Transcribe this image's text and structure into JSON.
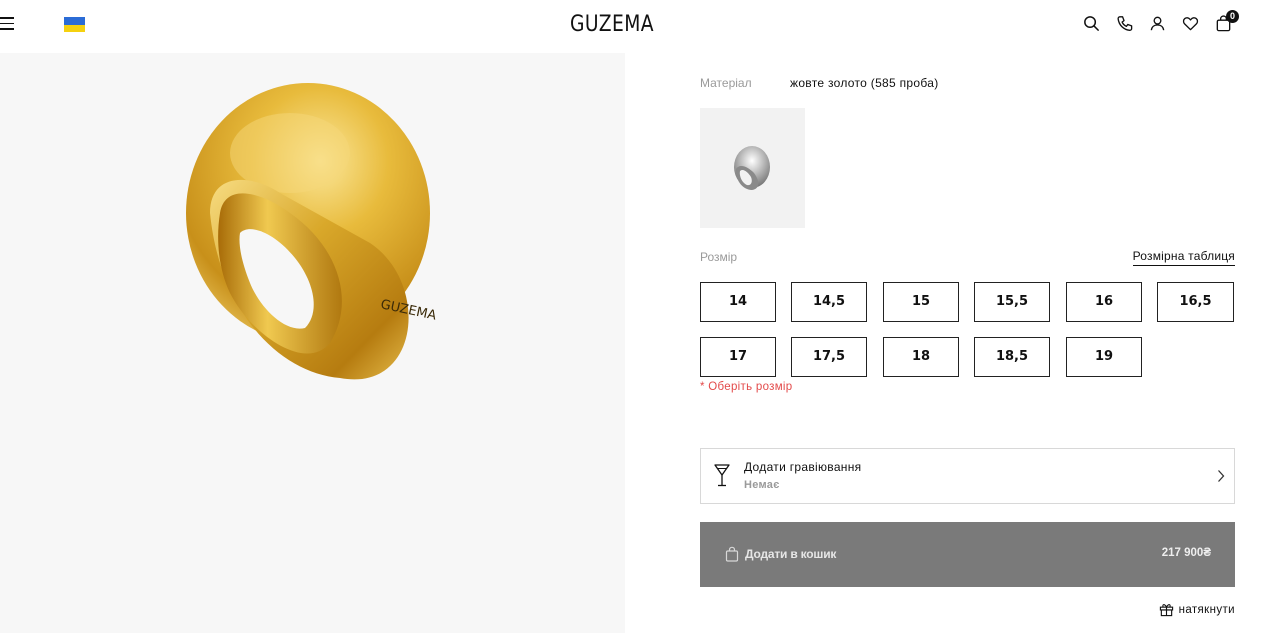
{
  "header": {
    "logo": "GUZEMA",
    "cart_count": "0",
    "icons": [
      "menu-icon",
      "ukraine-flag-icon",
      "search-icon",
      "phone-icon",
      "user-icon",
      "heart-icon",
      "bag-icon"
    ]
  },
  "product": {
    "material_label": "Матеріал",
    "material_value": "жовте золото (585 проба)",
    "engraving_on_ring": "GUZEMA"
  },
  "size": {
    "label": "Розмір",
    "table_link": "Розмірна таблиця",
    "options": [
      "14",
      "14,5",
      "15",
      "15,5",
      "16",
      "16,5",
      "17",
      "17,5",
      "18",
      "18,5",
      "19"
    ],
    "error": "* Оберіть розмір"
  },
  "engraving": {
    "title": "Додати гравіювання",
    "value": "Немає"
  },
  "cart": {
    "label": "Додати в кошик",
    "price": "217 900₴"
  },
  "hint": {
    "label": "натякнути"
  },
  "colors": {
    "gold": "#d9a82a",
    "button_bg": "#7a7a7a",
    "error": "#e34a4a",
    "gallery_bg": "#f7f7f7"
  }
}
